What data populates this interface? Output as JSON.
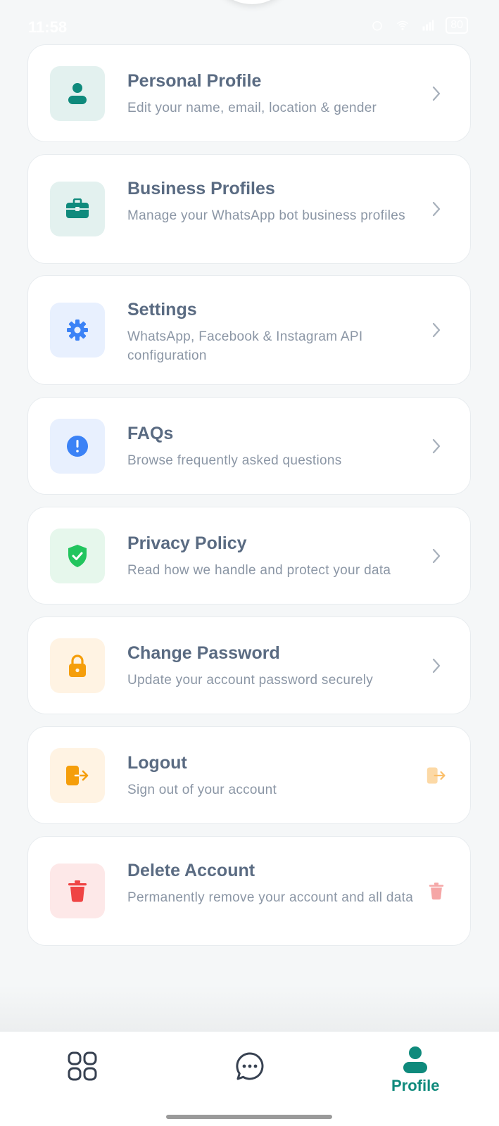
{
  "status_bar": {
    "time": "11:58",
    "battery": "80"
  },
  "menu": [
    {
      "title": "Personal Profile",
      "subtitle": "Edit your name, email, location & gender",
      "icon": "person-icon",
      "icon_bg": "#e3f1ef",
      "icon_color": "#0f8a7c"
    },
    {
      "title": "Business Profiles",
      "subtitle": "Manage your WhatsApp bot business profiles",
      "icon": "briefcase-icon",
      "icon_bg": "#e3f1ef",
      "icon_color": "#0f8a7c"
    },
    {
      "title": "Settings",
      "subtitle": "WhatsApp, Facebook & Instagram API configuration",
      "icon": "gear-icon",
      "icon_bg": "#e8f0fe",
      "icon_color": "#3b82f6"
    },
    {
      "title": "FAQs",
      "subtitle": "Browse frequently asked questions",
      "icon": "info-icon",
      "icon_bg": "#e8f0fe",
      "icon_color": "#3b82f6"
    },
    {
      "title": "Privacy Policy",
      "subtitle": "Read how we handle and protect your data",
      "icon": "shield-icon",
      "icon_bg": "#e6f7ec",
      "icon_color": "#22c55e"
    },
    {
      "title": "Change Password",
      "subtitle": "Update your account password securely",
      "icon": "lock-icon",
      "icon_bg": "#fff3e3",
      "icon_color": "#f59e0b"
    },
    {
      "title": "Logout",
      "subtitle": "Sign out of your account",
      "icon": "logout-icon",
      "icon_bg": "#fff3e3",
      "icon_color": "#f59e0b"
    },
    {
      "title": "Delete Account",
      "subtitle": "Permanently remove your account and all data",
      "icon": "trash-icon",
      "icon_bg": "#fde8e8",
      "icon_color": "#ef4444"
    }
  ],
  "bottom_nav": {
    "items": [
      {
        "icon": "grid-icon"
      },
      {
        "icon": "chat-icon"
      },
      {
        "icon": "person-icon",
        "label": "Profile",
        "active": true
      }
    ]
  },
  "colors": {
    "accent": "#0f8a7c",
    "title": "#5a6b82",
    "subtitle": "#8b96a5",
    "chevron": "#a7b0bb"
  }
}
